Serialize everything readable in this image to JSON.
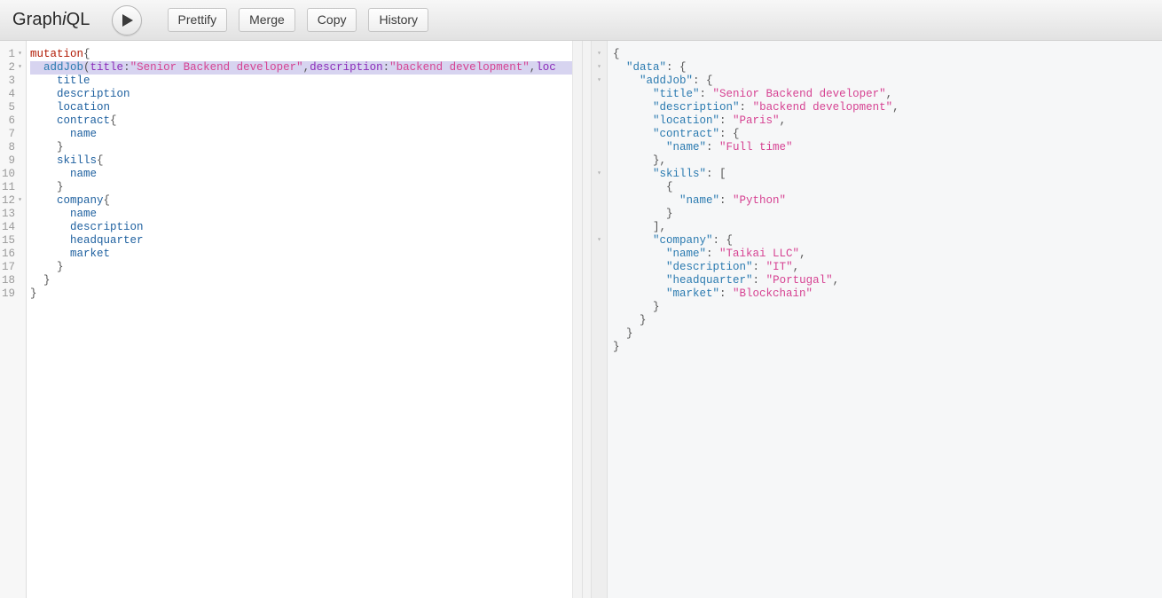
{
  "header": {
    "logo_prefix": "Graph",
    "logo_italic": "i",
    "logo_suffix": "QL",
    "execute_title": "Execute Query",
    "buttons": [
      {
        "label": "Prettify",
        "name": "prettify-button"
      },
      {
        "label": "Merge",
        "name": "merge-button"
      },
      {
        "label": "Copy",
        "name": "copy-button"
      },
      {
        "label": "History",
        "name": "history-button"
      }
    ]
  },
  "query_editor": {
    "lines": [
      {
        "number": "1",
        "fold": "▾",
        "selected": false,
        "tokens": [
          {
            "text": "mutation",
            "cls": "t-kw"
          },
          {
            "text": "{",
            "cls": "t-punc"
          }
        ]
      },
      {
        "number": "2",
        "fold": "▾",
        "selected": true,
        "tokens": [
          {
            "text": "  ",
            "cls": "t-punc"
          },
          {
            "text": "addJob",
            "cls": "t-def"
          },
          {
            "text": "(",
            "cls": "t-punc"
          },
          {
            "text": "title",
            "cls": "t-attr"
          },
          {
            "text": ":",
            "cls": "t-punc"
          },
          {
            "text": "\"Senior Backend developer\"",
            "cls": "t-str"
          },
          {
            "text": ",",
            "cls": "t-punc"
          },
          {
            "text": "description",
            "cls": "t-attr"
          },
          {
            "text": ":",
            "cls": "t-punc"
          },
          {
            "text": "\"backend development\"",
            "cls": "t-str"
          },
          {
            "text": ",",
            "cls": "t-punc"
          },
          {
            "text": "loc",
            "cls": "t-attr"
          }
        ]
      },
      {
        "number": "3",
        "fold": "",
        "selected": false,
        "tokens": [
          {
            "text": "    title",
            "cls": "t-field"
          }
        ]
      },
      {
        "number": "4",
        "fold": "",
        "selected": false,
        "tokens": [
          {
            "text": "    description",
            "cls": "t-field"
          }
        ]
      },
      {
        "number": "5",
        "fold": "",
        "selected": false,
        "tokens": [
          {
            "text": "    location",
            "cls": "t-field"
          }
        ]
      },
      {
        "number": "6",
        "fold": "",
        "selected": false,
        "tokens": [
          {
            "text": "    contract",
            "cls": "t-field"
          },
          {
            "text": "{",
            "cls": "t-punc"
          }
        ]
      },
      {
        "number": "7",
        "fold": "",
        "selected": false,
        "tokens": [
          {
            "text": "      name",
            "cls": "t-field"
          }
        ]
      },
      {
        "number": "8",
        "fold": "",
        "selected": false,
        "tokens": [
          {
            "text": "    }",
            "cls": "t-punc"
          }
        ]
      },
      {
        "number": "9",
        "fold": "",
        "selected": false,
        "tokens": [
          {
            "text": "    skills",
            "cls": "t-field"
          },
          {
            "text": "{",
            "cls": "t-punc"
          }
        ]
      },
      {
        "number": "10",
        "fold": "",
        "selected": false,
        "tokens": [
          {
            "text": "      name",
            "cls": "t-field"
          }
        ]
      },
      {
        "number": "11",
        "fold": "",
        "selected": false,
        "tokens": [
          {
            "text": "    }",
            "cls": "t-punc"
          }
        ]
      },
      {
        "number": "12",
        "fold": "▾",
        "selected": false,
        "tokens": [
          {
            "text": "    company",
            "cls": "t-field"
          },
          {
            "text": "{",
            "cls": "t-punc"
          }
        ]
      },
      {
        "number": "13",
        "fold": "",
        "selected": false,
        "tokens": [
          {
            "text": "      name",
            "cls": "t-field"
          }
        ]
      },
      {
        "number": "14",
        "fold": "",
        "selected": false,
        "tokens": [
          {
            "text": "      description",
            "cls": "t-field"
          }
        ]
      },
      {
        "number": "15",
        "fold": "",
        "selected": false,
        "tokens": [
          {
            "text": "      headquarter",
            "cls": "t-field"
          }
        ]
      },
      {
        "number": "16",
        "fold": "",
        "selected": false,
        "tokens": [
          {
            "text": "      market",
            "cls": "t-field"
          }
        ]
      },
      {
        "number": "17",
        "fold": "",
        "selected": false,
        "tokens": [
          {
            "text": "    }",
            "cls": "t-punc"
          }
        ]
      },
      {
        "number": "18",
        "fold": "",
        "selected": false,
        "tokens": [
          {
            "text": "  }",
            "cls": "t-punc"
          }
        ]
      },
      {
        "number": "19",
        "fold": "",
        "selected": false,
        "tokens": [
          {
            "text": "}",
            "cls": "t-punc"
          }
        ]
      }
    ]
  },
  "result_pane": {
    "lines": [
      {
        "fold": "▾",
        "tokens": [
          {
            "text": "{",
            "cls": "j-punc"
          }
        ]
      },
      {
        "fold": "▾",
        "tokens": [
          {
            "text": "  ",
            "cls": "j-punc"
          },
          {
            "text": "\"data\"",
            "cls": "j-key"
          },
          {
            "text": ": {",
            "cls": "j-punc"
          }
        ]
      },
      {
        "fold": "▾",
        "tokens": [
          {
            "text": "    ",
            "cls": "j-punc"
          },
          {
            "text": "\"addJob\"",
            "cls": "j-key"
          },
          {
            "text": ": {",
            "cls": "j-punc"
          }
        ]
      },
      {
        "fold": "",
        "tokens": [
          {
            "text": "      ",
            "cls": "j-punc"
          },
          {
            "text": "\"title\"",
            "cls": "j-key"
          },
          {
            "text": ": ",
            "cls": "j-punc"
          },
          {
            "text": "\"Senior Backend developer\"",
            "cls": "j-str"
          },
          {
            "text": ",",
            "cls": "j-punc"
          }
        ]
      },
      {
        "fold": "",
        "tokens": [
          {
            "text": "      ",
            "cls": "j-punc"
          },
          {
            "text": "\"description\"",
            "cls": "j-key"
          },
          {
            "text": ": ",
            "cls": "j-punc"
          },
          {
            "text": "\"backend development\"",
            "cls": "j-str"
          },
          {
            "text": ",",
            "cls": "j-punc"
          }
        ]
      },
      {
        "fold": "",
        "tokens": [
          {
            "text": "      ",
            "cls": "j-punc"
          },
          {
            "text": "\"location\"",
            "cls": "j-key"
          },
          {
            "text": ": ",
            "cls": "j-punc"
          },
          {
            "text": "\"Paris\"",
            "cls": "j-str"
          },
          {
            "text": ",",
            "cls": "j-punc"
          }
        ]
      },
      {
        "fold": "",
        "tokens": [
          {
            "text": "      ",
            "cls": "j-punc"
          },
          {
            "text": "\"contract\"",
            "cls": "j-key"
          },
          {
            "text": ": {",
            "cls": "j-punc"
          }
        ]
      },
      {
        "fold": "",
        "tokens": [
          {
            "text": "        ",
            "cls": "j-punc"
          },
          {
            "text": "\"name\"",
            "cls": "j-key"
          },
          {
            "text": ": ",
            "cls": "j-punc"
          },
          {
            "text": "\"Full time\"",
            "cls": "j-str"
          }
        ]
      },
      {
        "fold": "",
        "tokens": [
          {
            "text": "      },",
            "cls": "j-punc"
          }
        ]
      },
      {
        "fold": "▾",
        "tokens": [
          {
            "text": "      ",
            "cls": "j-punc"
          },
          {
            "text": "\"skills\"",
            "cls": "j-key"
          },
          {
            "text": ": [",
            "cls": "j-punc"
          }
        ]
      },
      {
        "fold": "",
        "tokens": [
          {
            "text": "        {",
            "cls": "j-punc"
          }
        ]
      },
      {
        "fold": "",
        "tokens": [
          {
            "text": "          ",
            "cls": "j-punc"
          },
          {
            "text": "\"name\"",
            "cls": "j-key"
          },
          {
            "text": ": ",
            "cls": "j-punc"
          },
          {
            "text": "\"Python\"",
            "cls": "j-str"
          }
        ]
      },
      {
        "fold": "",
        "tokens": [
          {
            "text": "        }",
            "cls": "j-punc"
          }
        ]
      },
      {
        "fold": "",
        "tokens": [
          {
            "text": "      ],",
            "cls": "j-punc"
          }
        ]
      },
      {
        "fold": "▾",
        "tokens": [
          {
            "text": "      ",
            "cls": "j-punc"
          },
          {
            "text": "\"company\"",
            "cls": "j-key"
          },
          {
            "text": ": {",
            "cls": "j-punc"
          }
        ]
      },
      {
        "fold": "",
        "tokens": [
          {
            "text": "        ",
            "cls": "j-punc"
          },
          {
            "text": "\"name\"",
            "cls": "j-key"
          },
          {
            "text": ": ",
            "cls": "j-punc"
          },
          {
            "text": "\"Taikai LLC\"",
            "cls": "j-str"
          },
          {
            "text": ",",
            "cls": "j-punc"
          }
        ]
      },
      {
        "fold": "",
        "tokens": [
          {
            "text": "        ",
            "cls": "j-punc"
          },
          {
            "text": "\"description\"",
            "cls": "j-key"
          },
          {
            "text": ": ",
            "cls": "j-punc"
          },
          {
            "text": "\"IT\"",
            "cls": "j-str"
          },
          {
            "text": ",",
            "cls": "j-punc"
          }
        ]
      },
      {
        "fold": "",
        "tokens": [
          {
            "text": "        ",
            "cls": "j-punc"
          },
          {
            "text": "\"headquarter\"",
            "cls": "j-key"
          },
          {
            "text": ": ",
            "cls": "j-punc"
          },
          {
            "text": "\"Portugal\"",
            "cls": "j-str"
          },
          {
            "text": ",",
            "cls": "j-punc"
          }
        ]
      },
      {
        "fold": "",
        "tokens": [
          {
            "text": "        ",
            "cls": "j-punc"
          },
          {
            "text": "\"market\"",
            "cls": "j-key"
          },
          {
            "text": ": ",
            "cls": "j-punc"
          },
          {
            "text": "\"Blockchain\"",
            "cls": "j-str"
          }
        ]
      },
      {
        "fold": "",
        "tokens": [
          {
            "text": "      }",
            "cls": "j-punc"
          }
        ]
      },
      {
        "fold": "",
        "tokens": [
          {
            "text": "    }",
            "cls": "j-punc"
          }
        ]
      },
      {
        "fold": "",
        "tokens": [
          {
            "text": "  }",
            "cls": "j-punc"
          }
        ]
      },
      {
        "fold": "",
        "tokens": [
          {
            "text": "}",
            "cls": "j-punc"
          }
        ]
      }
    ]
  },
  "colors": {
    "keyword": "#b11a04",
    "definition": "#2a7ab0",
    "attribute": "#8b2bb9",
    "string": "#d64292",
    "field": "#1f61a0",
    "selection": "#d7d4f0",
    "result_bg": "#f6f7f8",
    "editor_bg": "#ffffff"
  }
}
